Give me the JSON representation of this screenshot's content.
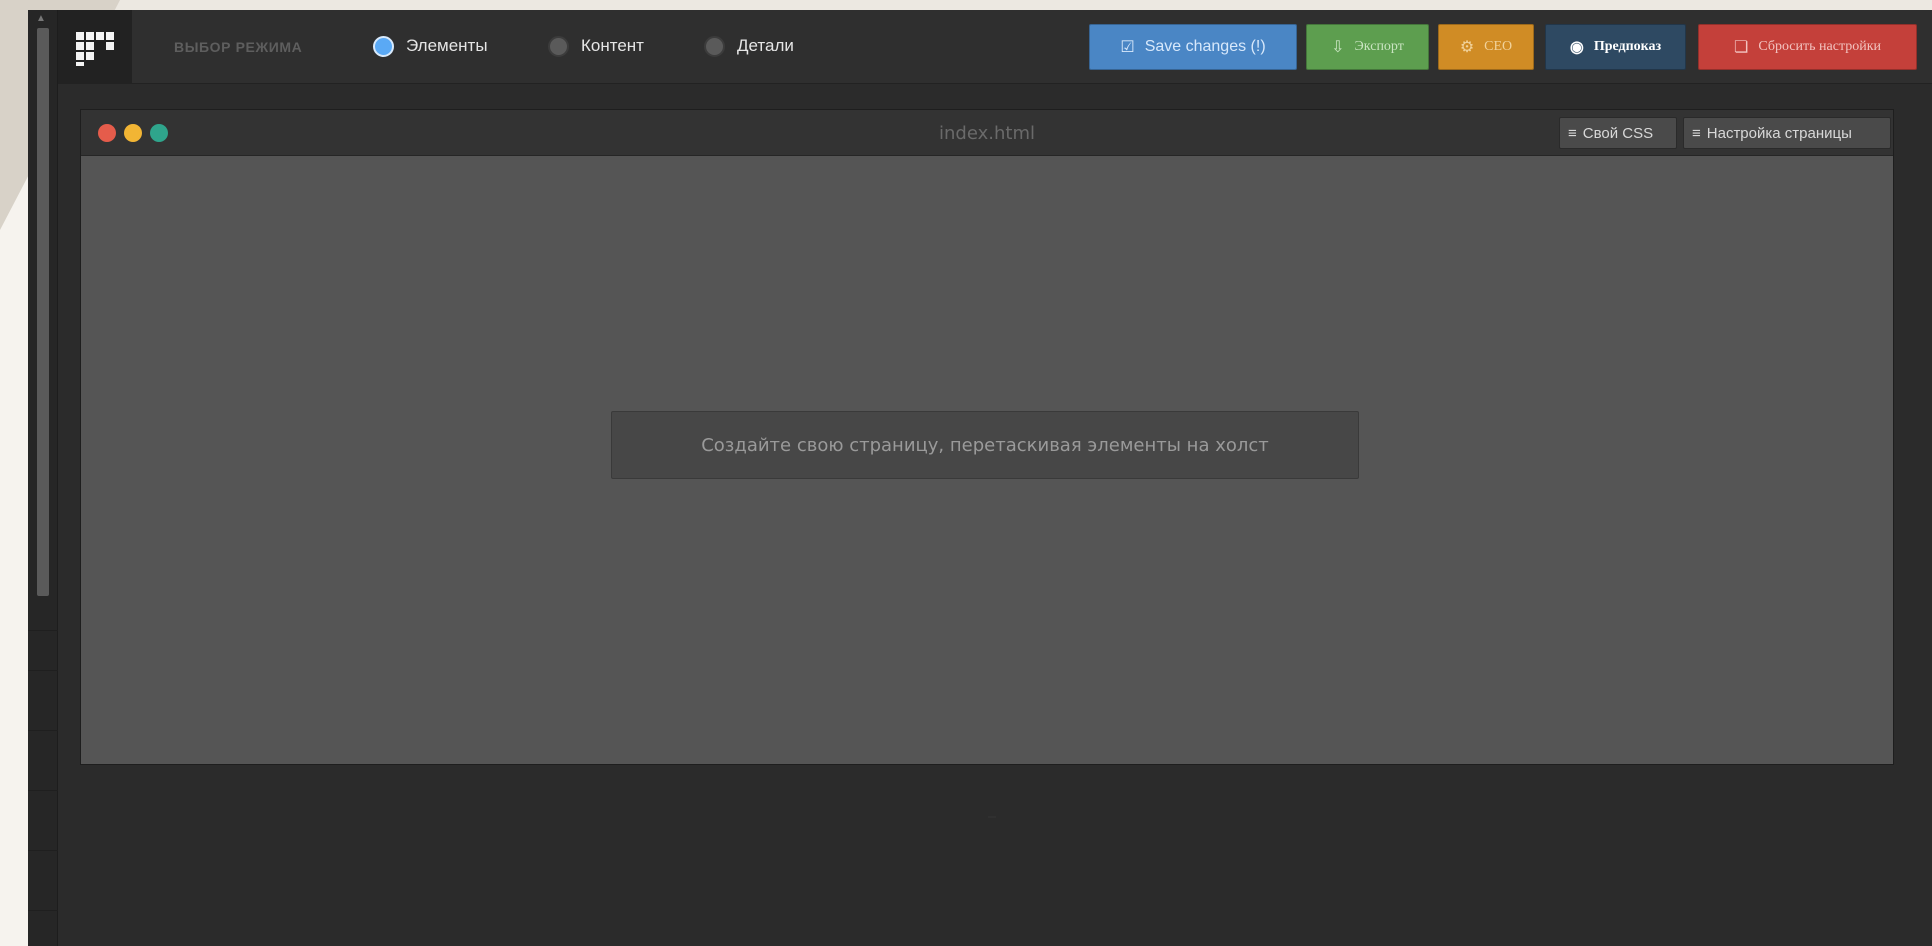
{
  "toolbar": {
    "mode_label": "ВЫБОР РЕЖИМА",
    "modes": [
      {
        "label": "Элементы",
        "active": true
      },
      {
        "label": "Контент",
        "active": false
      },
      {
        "label": "Детали",
        "active": false
      }
    ],
    "save_label": "Save changes (!)",
    "export_label": "Экспорт",
    "seo_label": "СЕО",
    "preview_label": "Предпоказ",
    "reset_label": "Сбросить настройки"
  },
  "window": {
    "title": "index.html",
    "css_label": "Свой CSS",
    "page_settings_label": "Настройка страницы"
  },
  "canvas": {
    "placeholder": "Создайте свою страницу, перетаскивая элементы на холст"
  },
  "colors": {
    "save": "#4a86c5",
    "export": "#5d9e4f",
    "seo": "#d08c25",
    "preview": "#2e4962",
    "reset": "#c4403a",
    "active_mode": "#5aa9f5"
  },
  "icons": {
    "logo": "pixel-logo-icon",
    "save": "checkbox-icon",
    "export": "download-icon",
    "seo": "gear-icon",
    "preview": "eye-icon",
    "reset": "trash-icon",
    "css": "css3-icon",
    "page_settings": "menu-icon"
  }
}
